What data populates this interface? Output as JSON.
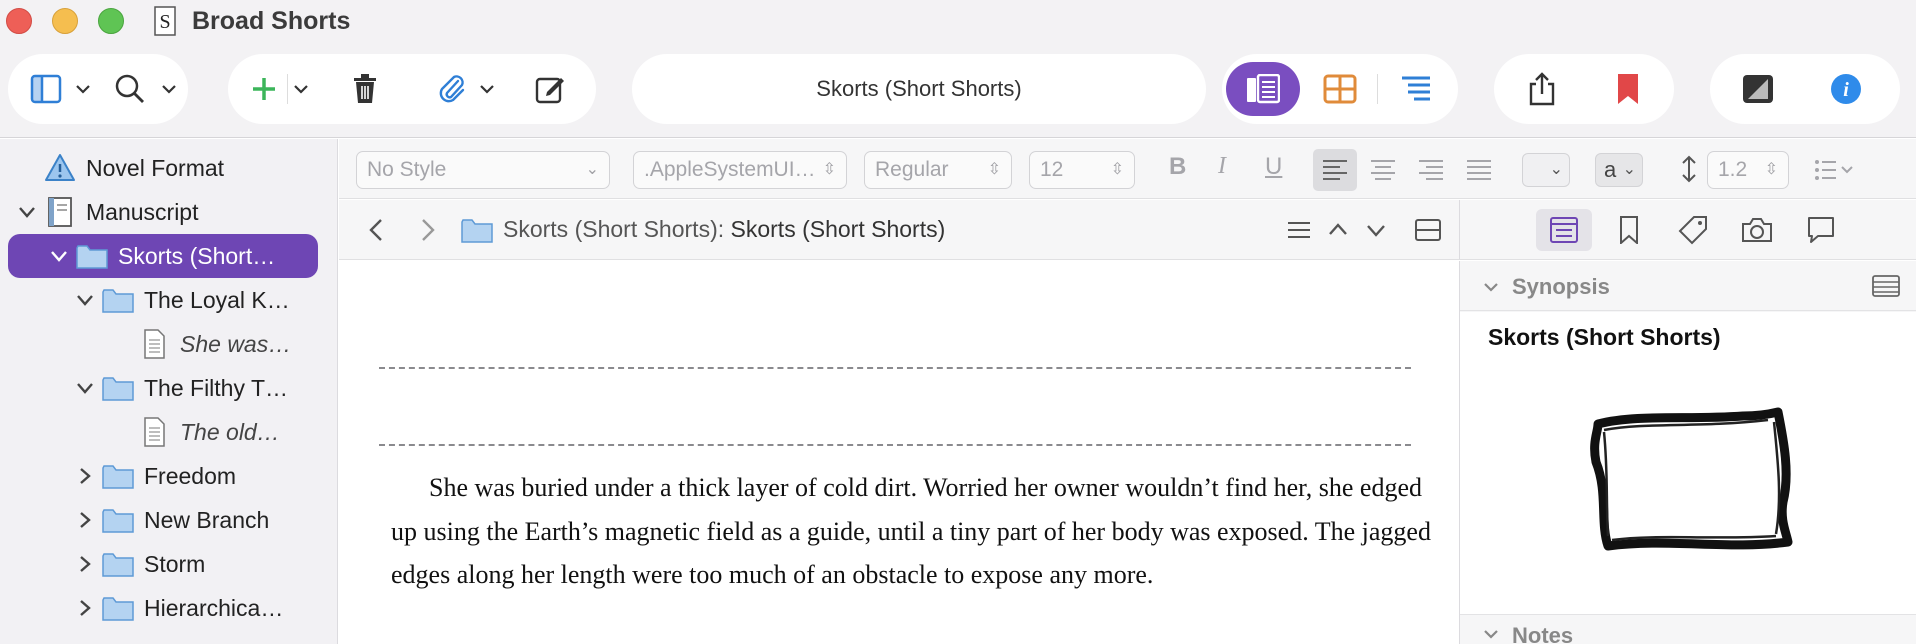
{
  "window": {
    "title": "Broad Shorts"
  },
  "toolbar": {
    "document_title": "Skorts (Short Shorts)",
    "icons": [
      "sidebar-toggle-icon",
      "search-icon",
      "add-icon",
      "trash-icon",
      "attachment-icon",
      "compose-icon",
      "composition-icon",
      "corkboard-icon",
      "outline-icon",
      "share-icon",
      "bookmark-icon",
      "theme-icon",
      "info-icon"
    ],
    "accent": "#6e46b4"
  },
  "binder": {
    "items": [
      {
        "label": "Novel Format",
        "icon": "warning-icon",
        "depth": 0,
        "disclosure": "none"
      },
      {
        "label": "Manuscript",
        "icon": "manuscript-icon",
        "depth": 0,
        "disclosure": "open"
      },
      {
        "label": "Skorts (Short…",
        "icon": "folder-icon",
        "depth": 1,
        "disclosure": "open",
        "selected": true
      },
      {
        "label": "The Loyal K…",
        "icon": "folder-icon",
        "depth": 2,
        "disclosure": "open"
      },
      {
        "label": "She was…",
        "icon": "document-icon",
        "depth": 3,
        "disclosure": "none",
        "italic": true
      },
      {
        "label": "The Filthy T…",
        "icon": "folder-icon",
        "depth": 2,
        "disclosure": "open"
      },
      {
        "label": "The old…",
        "icon": "document-icon",
        "depth": 3,
        "disclosure": "none",
        "italic": true
      },
      {
        "label": "Freedom",
        "icon": "folder-icon",
        "depth": 2,
        "disclosure": "closed"
      },
      {
        "label": "New Branch",
        "icon": "folder-icon",
        "depth": 2,
        "disclosure": "closed"
      },
      {
        "label": "Storm",
        "icon": "folder-icon",
        "depth": 2,
        "disclosure": "closed"
      },
      {
        "label": "Hierarchica…",
        "icon": "folder-icon",
        "depth": 2,
        "disclosure": "closed"
      }
    ]
  },
  "format_bar": {
    "style": "No Style",
    "font": ".AppleSystemUI…",
    "weight": "Regular",
    "size": "12",
    "bold": "B",
    "italic": "I",
    "underline": "U",
    "highlight": "a",
    "line_spacing": "1.2"
  },
  "editor": {
    "path_prefix": "Skorts (Short Shorts):",
    "path_title": "Skorts (Short Shorts)",
    "body": "She was buried under a thick layer of cold dirt. Worried her owner wouldn’t find her, she edged up using the Earth’s magnetic field as a guide, until a tiny part of her body was exposed. The jagged edges along her length were too much of an obstacle to expose any more."
  },
  "inspector": {
    "synopsis_label": "Synopsis",
    "synopsis_title": "Skorts (Short Shorts)",
    "notes_label": "Notes"
  }
}
